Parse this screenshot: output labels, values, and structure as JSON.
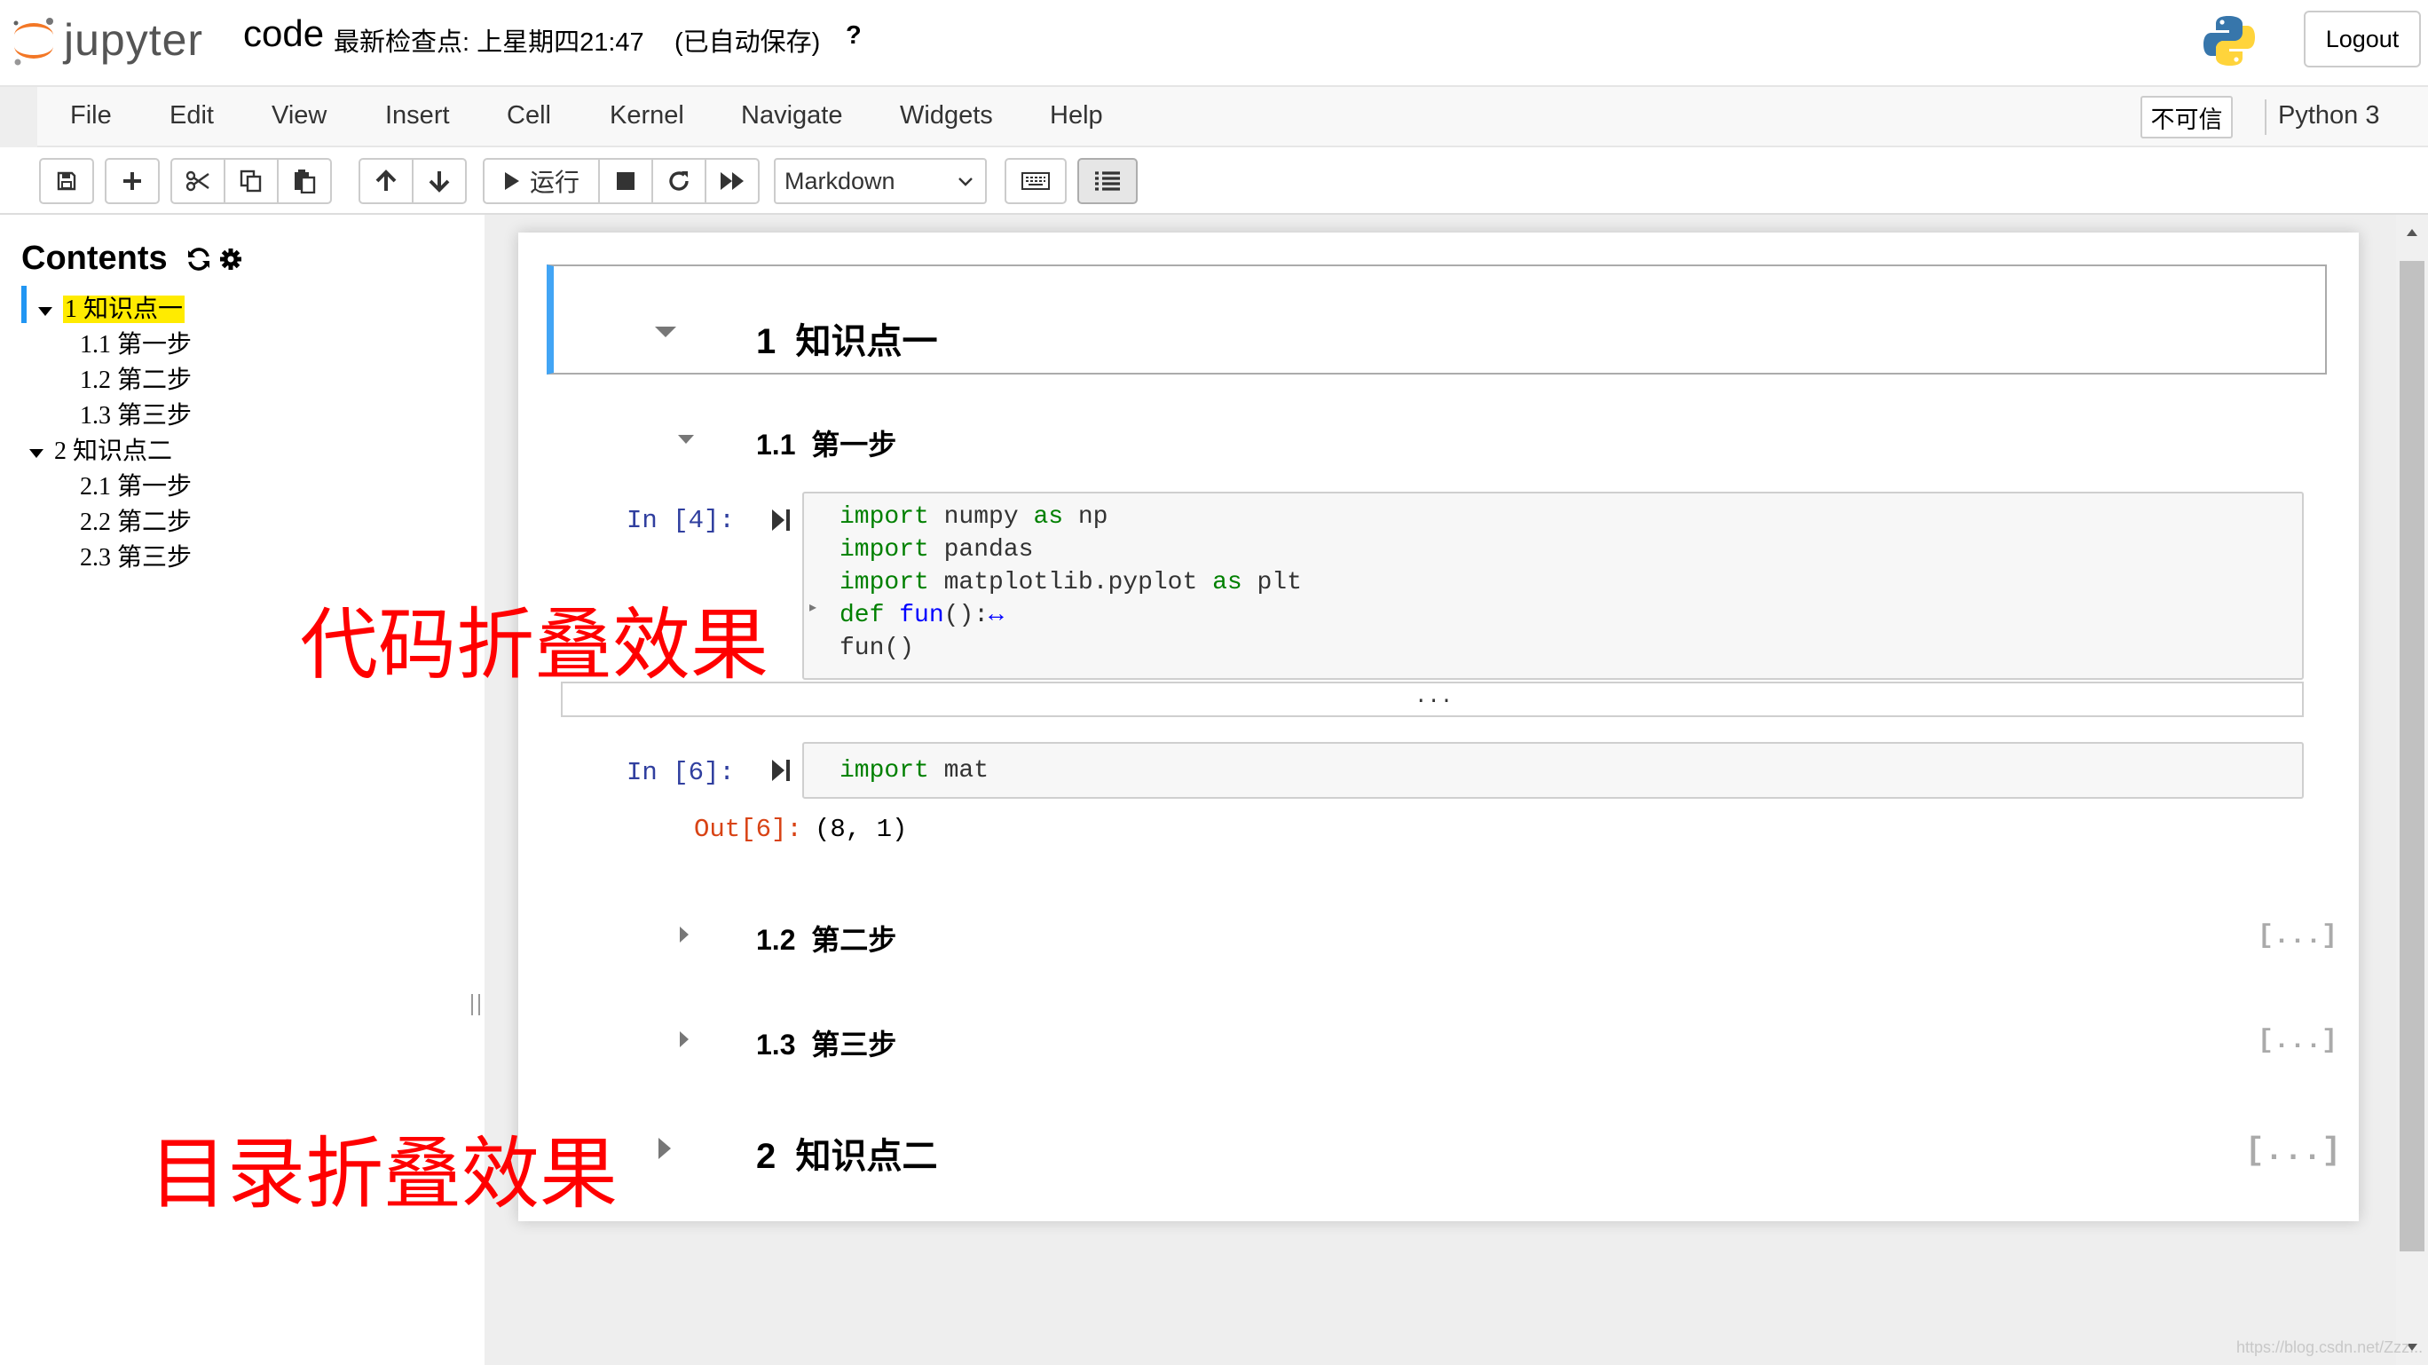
{
  "header": {
    "logo_text": "jupyter",
    "notebook_name": "code",
    "checkpoint": "最新检查点: 上星期四21:47",
    "autosave": "(已自动保存)",
    "help": "?",
    "logout": "Logout"
  },
  "menubar": {
    "items": [
      "File",
      "Edit",
      "View",
      "Insert",
      "Cell",
      "Kernel",
      "Navigate",
      "Widgets",
      "Help"
    ],
    "not_trusted": "不可信",
    "kernel": "Python 3"
  },
  "toolbar": {
    "run_label": "运行",
    "cell_type": "Markdown"
  },
  "toc": {
    "title": "Contents",
    "items": [
      {
        "num": "1",
        "label": "知识点一"
      },
      {
        "num": "1.1",
        "label": "第一步"
      },
      {
        "num": "1.2",
        "label": "第二步"
      },
      {
        "num": "1.3",
        "label": "第三步"
      },
      {
        "num": "2",
        "label": "知识点二"
      },
      {
        "num": "2.1",
        "label": "第一步"
      },
      {
        "num": "2.2",
        "label": "第二步"
      },
      {
        "num": "2.3",
        "label": "第三步"
      }
    ]
  },
  "notebook": {
    "h1_1": {
      "num": "1",
      "text": "知识点一"
    },
    "h2_1": {
      "num": "1.1",
      "text": "第一步"
    },
    "cell1": {
      "prompt": "In  [4]:",
      "lines": [
        {
          "kw1": "import",
          "rest": " numpy ",
          "kw2": "as",
          "rest2": " np"
        },
        {
          "kw1": "import",
          "rest": " pandas"
        },
        {
          "kw1": "import",
          "rest": " matplotlib.pyplot ",
          "kw2": "as",
          "rest2": " plt"
        },
        {
          "kw1": "def",
          "fn": " fun",
          "rest": "():",
          "arrow": "↔"
        },
        {
          "rest": "fun()"
        }
      ],
      "fold_marker": "▸",
      "output_collapsed": "..."
    },
    "cell2": {
      "prompt": "In  [6]:",
      "code_kw": "import",
      "code_rest": " mat",
      "out_prompt": "Out[6]:",
      "output": "(8,  1)"
    },
    "h2_2": {
      "num": "1.2",
      "text": "第二步"
    },
    "h2_3": {
      "num": "1.3",
      "text": "第三步"
    },
    "h1_2": {
      "num": "2",
      "text": "知识点二"
    },
    "collapsed_marker": "[...]"
  },
  "annotations": {
    "code_fold": "代码折叠效果",
    "toc_fold": "目录折叠效果"
  },
  "watermark": "https://blog.csdn.net/Zzz..."
}
